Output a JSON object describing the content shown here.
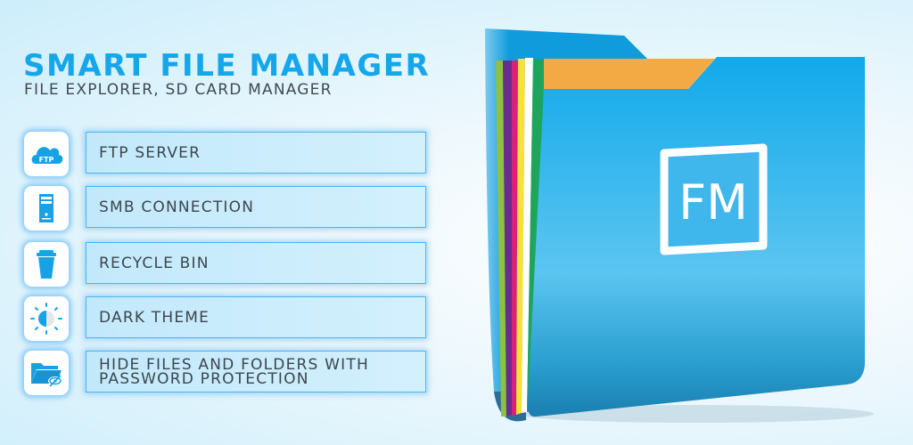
{
  "header": {
    "title": "SMART FILE MANAGER",
    "subtitle": "FILE EXPLORER, SD CARD MANAGER"
  },
  "features": [
    {
      "icon": "cloud-ftp-icon",
      "icon_text": "FTP",
      "label": "FTP SERVER"
    },
    {
      "icon": "server-icon",
      "label": "SMB CONNECTION"
    },
    {
      "icon": "trash-bin-icon",
      "label": "RECYCLE BIN"
    },
    {
      "icon": "half-sun-theme-icon",
      "label": "DARK THEME"
    },
    {
      "icon": "hidden-folder-icon",
      "label": "HIDE FILES AND FOLDERS WITH\nPASSWORD PROTECTION"
    }
  ],
  "illustration": {
    "logo_text": "FM",
    "colors": {
      "folder_blue": "#12a9ea",
      "tab_orange": "#f3aa45",
      "papers": [
        "#8dc13f",
        "#6a2c8f",
        "#d9207a",
        "#f5e13a",
        "#ffffff",
        "#1fa55b"
      ]
    }
  },
  "theme": {
    "accent": "#16a6ea",
    "text_dark": "#3c464e"
  }
}
